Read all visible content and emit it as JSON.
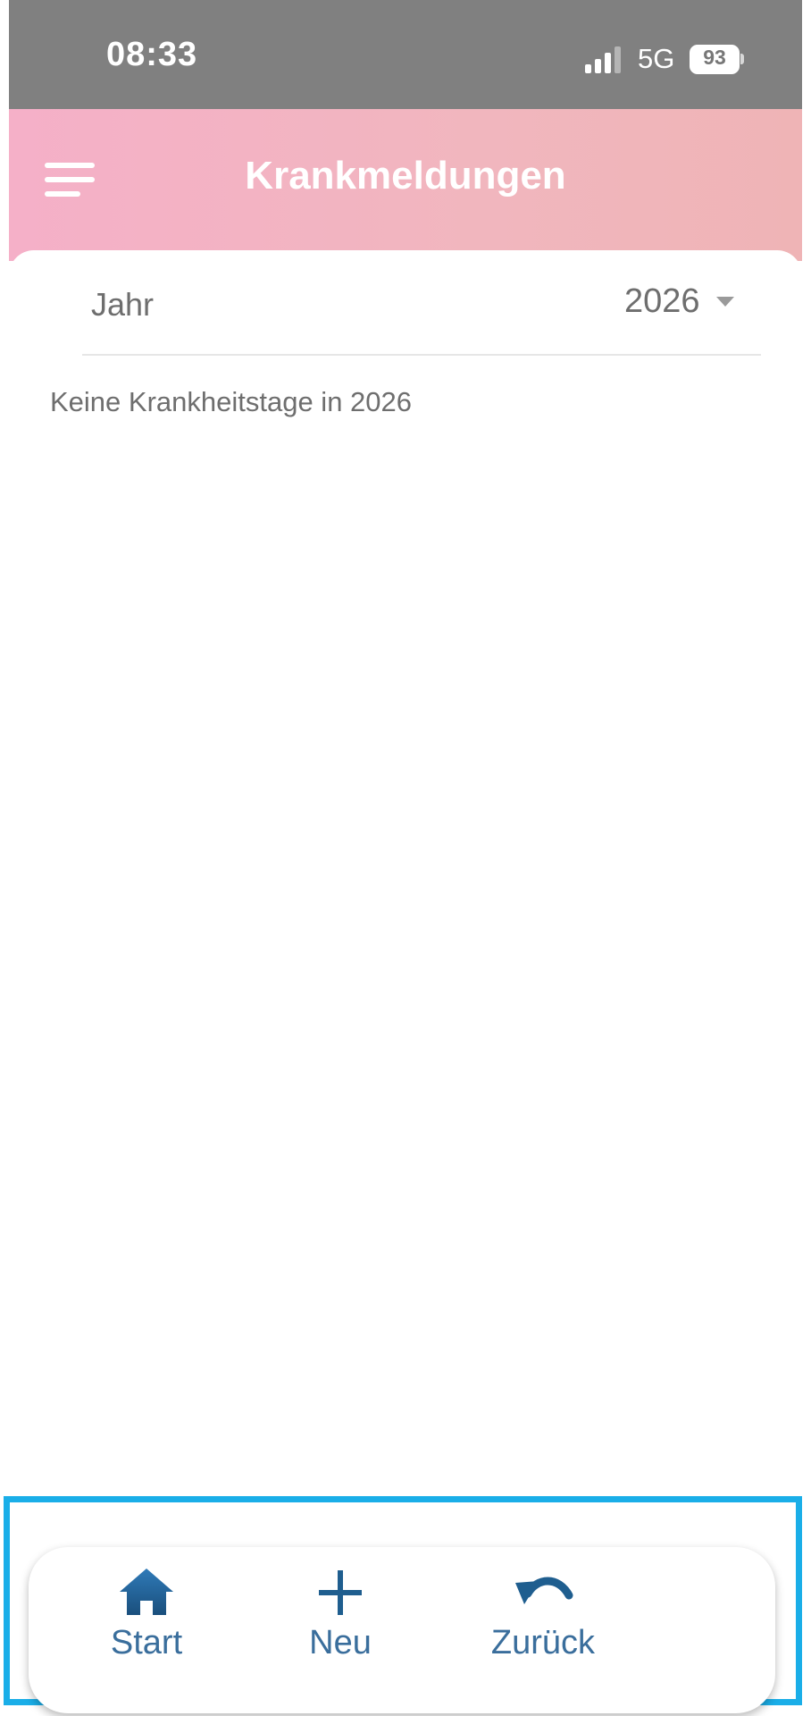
{
  "status_bar": {
    "time": "08:33",
    "network": "5G",
    "battery": "93",
    "signal_icon": "cellular-signal-icon",
    "battery_icon": "battery-icon"
  },
  "header": {
    "title": "Krankmeldungen",
    "menu_icon": "hamburger-menu-icon",
    "gradient_colors": [
      "#f5b0c8",
      "#efb4b6"
    ]
  },
  "filter": {
    "label": "Jahr",
    "selected_year": "2026",
    "dropdown_icon": "chevron-down-icon"
  },
  "content": {
    "empty_message": "Keine Krankheitstage in 2026"
  },
  "bottom_nav": {
    "accent_color": "#1f5e8f",
    "frame_color": "#1aaee8",
    "items": [
      {
        "label": "Start",
        "icon": "home-icon"
      },
      {
        "label": "Neu",
        "icon": "plus-icon"
      },
      {
        "label": "Zurück",
        "icon": "undo-arrow-icon"
      }
    ]
  }
}
